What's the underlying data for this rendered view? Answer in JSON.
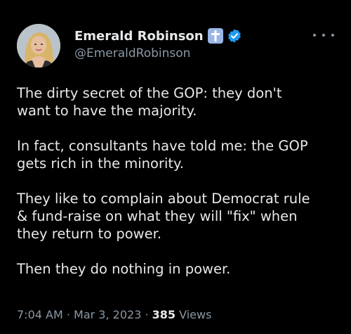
{
  "author": {
    "display_name": "Emerald Robinson",
    "handle": "@EmeraldRobinson",
    "avatar_icon": "profile-photo",
    "badges": [
      "latin-cross-icon",
      "verified-badge-icon"
    ]
  },
  "tweet": {
    "paragraphs": [
      "The dirty secret of the GOP: they don't\nwant to have the majority.",
      "In fact, consultants have told me: the GOP\ngets rich in the minority.",
      "They like to complain about Democrat rule\n& fund-raise on what they will \"fix\" when\nthey return to power.",
      "Then they do nothing in power."
    ]
  },
  "meta": {
    "time": "7:04 AM",
    "separator": " · ",
    "date": "Mar 3, 2023",
    "views_count": "385",
    "views_label": " Views"
  },
  "colors": {
    "background": "#000000",
    "text_primary": "#e7e9ea",
    "text_secondary": "#8b98a5",
    "verified_blue": "#1d9bf0",
    "cross_badge": "#9ab5e6"
  }
}
